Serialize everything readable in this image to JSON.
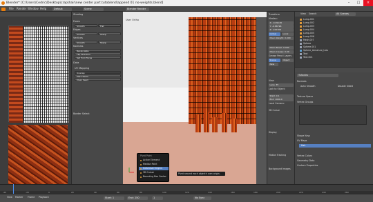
{
  "window": {
    "title": "Blender* [C:\\Users\\Cedric\\Desktop\\crap\\hair\\new center part.tutoblend\\append 01 no-weights.blend]"
  },
  "menubar": {
    "items": [
      "File",
      "Render",
      "Window",
      "Help"
    ],
    "mode": "Default",
    "scene": "Scene",
    "engine": "Blender Render"
  },
  "tool_panel": {
    "sections": [
      {
        "header": "Shading",
        "buttons": [
          "Smooth",
          "Flat"
        ]
      },
      {
        "header": "Faces",
        "buttons": [
          "Smooth",
          "Flat"
        ]
      },
      {
        "header": "Edges",
        "buttons": [
          "Smooth",
          "Sharp"
        ]
      },
      {
        "header": "Vertices",
        "buttons": [
          "Smooth",
          "Sharp"
        ]
      },
      {
        "header": "Normals",
        "buttons": [
          "Recalculate",
          "Flip Direction",
          "Set from Faces"
        ]
      },
      {
        "header": "Data",
        "buttons": [
          "UV Mapping",
          "Unwrap",
          "Mark Seam",
          "Clear Seam"
        ]
      }
    ],
    "footer": "Border Select"
  },
  "viewport": {
    "label": "User Ortho",
    "popup_menu": {
      "title": "Pivot Point",
      "items": [
        "Active Element",
        "Median Point",
        "Individual Origins",
        "3D Cursor",
        "Bounding Box Center"
      ],
      "selected_index": 2
    },
    "tooltip": "Pivot around each object's own origin.",
    "header_mode": "Edit Mode",
    "header_shading": "Global"
  },
  "n_panel": {
    "transform_header": "Transform",
    "median_label": "Median:",
    "x": "X: -0.09126",
    "y": "Y: -0.86796",
    "z": "Z: 1.06308",
    "global_local": [
      "Global",
      "Local"
    ],
    "mean_weight": "Mean Weight: 0.000",
    "mean_bevel": "Mean Bevel: 0.000",
    "mean_crease": "Mean Crease: 0.00",
    "grease_pencil": "Grease Pencil Layers",
    "scene_label": "Scene",
    "object_label": "Object",
    "new_label": "New",
    "view_header": "View",
    "lens": "Lens: 35",
    "lock_object": "Lock to Object:",
    "clip_start": "Start: 0.1",
    "clip_end": "End: 1000.0",
    "local_camera": "Local Camera:",
    "cursor_header": "3D Cursor",
    "display_header": "Display",
    "motion_tracking": "Motion Tracking",
    "background_images": "Background Images",
    "shading": "Shading",
    "background": "Background"
  },
  "outliner": {
    "view": "View",
    "search": "Search",
    "filter": "All Scenes",
    "items": [
      "Lamp.001",
      "Lamp.002",
      "Lamp.003",
      "Lamp.004",
      "Lamp.005",
      "Lamp.006",
      "Mesh.007",
      "Sphere",
      "Sphere.001",
      "Sphere_Armature_tuto",
      "Text",
      "Text.001"
    ]
  },
  "properties": {
    "object_name": "TuBodies",
    "normals_header": "Normals",
    "auto_smooth": "Auto Smooth",
    "double_sided": "Double Sided",
    "texture_space": "Texture Space",
    "vertex_groups": "Vertex Groups",
    "shape_keys": "Shape Keys",
    "uv_maps": "UV Maps",
    "uv_slot": "Hair",
    "vertex_colors": "Vertex Colors",
    "geometry_data": "Geometry Data",
    "custom_properties": "Custom Properties"
  },
  "timeline": {
    "ticks": [
      "-40",
      "-20",
      "0",
      "20",
      "40",
      "60",
      "80",
      "100",
      "120",
      "140",
      "160",
      "180",
      "200",
      "220",
      "240",
      "260"
    ],
    "menu": [
      "View",
      "Marker",
      "Frame",
      "Playback"
    ],
    "start": "Start: 1",
    "end": "End: 250",
    "frame": "1",
    "sync": "No Sync"
  },
  "colors": {
    "accent": "#5680c2",
    "hair_orange": "#e0621f",
    "skin": "#d9a693",
    "blender_orange": "#e87d0d"
  }
}
